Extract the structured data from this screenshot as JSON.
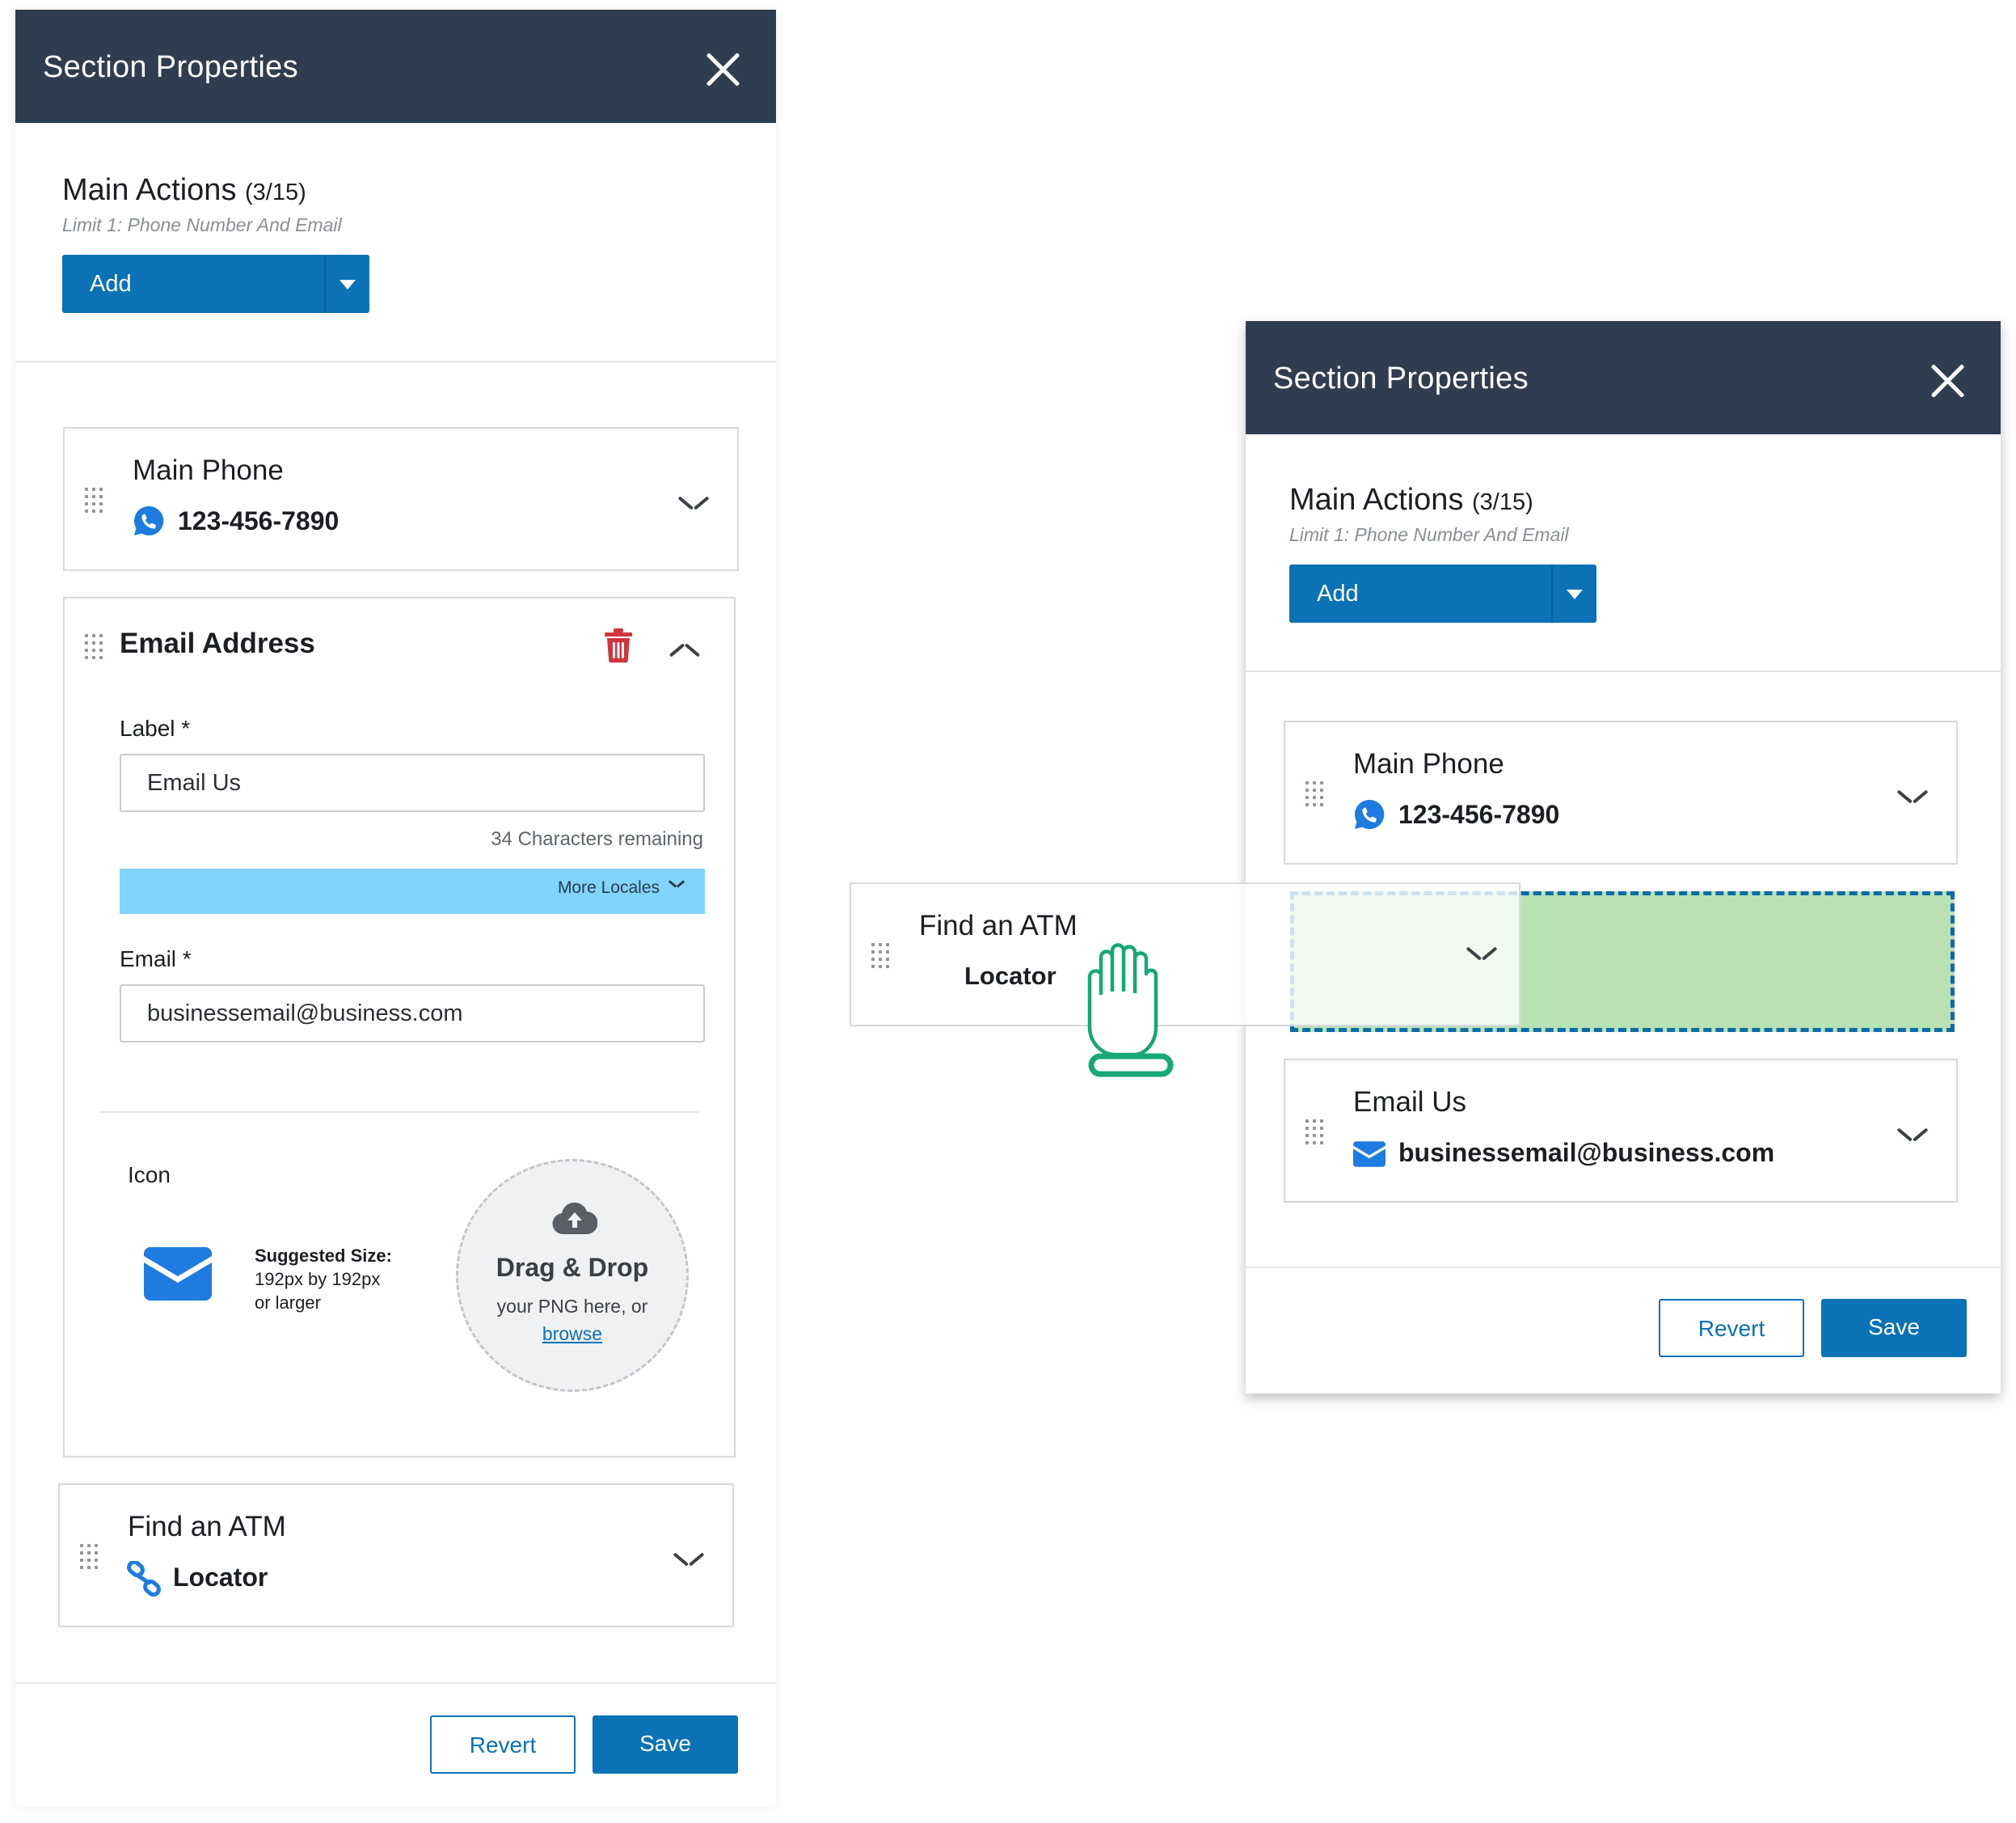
{
  "left_panel": {
    "title": "Section Properties",
    "main_actions": {
      "title": "Main Actions",
      "count": "(3/15)",
      "subtitle": "Limit 1: Phone Number And Email",
      "add_label": "Add"
    },
    "main_phone": {
      "title": "Main Phone",
      "value": "123-456-7890"
    },
    "email_card": {
      "title": "Email Address",
      "label_field": {
        "label": "Label *",
        "value": "Email Us"
      },
      "chars_remaining": "34 Characters remaining",
      "more_locales": "More Locales",
      "email_field": {
        "label": "Email *",
        "value": "businessemail@business.com"
      },
      "icon_label": "Icon",
      "suggested_size": {
        "heading": "Suggested Size:",
        "line1": "192px by 192px",
        "line2": "or larger"
      },
      "drop_zone": {
        "title": "Drag & Drop",
        "subtitle": "your PNG here, or",
        "link": "browse"
      }
    },
    "find_atm": {
      "title": "Find an ATM",
      "value": "Locator"
    },
    "revert_label": "Revert",
    "save_label": "Save"
  },
  "right_panel": {
    "title": "Section Properties",
    "main_actions": {
      "title": "Main Actions",
      "count": "(3/15)",
      "subtitle": "Limit 1: Phone Number And Email",
      "add_label": "Add"
    },
    "main_phone": {
      "title": "Main Phone",
      "value": "123-456-7890"
    },
    "email_us": {
      "title": "Email Us",
      "value": "businessemail@business.com"
    },
    "revert_label": "Revert",
    "save_label": "Save"
  },
  "dragged_card": {
    "title": "Find an ATM",
    "value": "Locator"
  },
  "icons": {
    "phone": "whatsapp-phone-icon",
    "email": "envelope-icon",
    "link": "chain-link-icon",
    "delete": "trash-icon",
    "upload": "cloud-upload-icon",
    "cursor": "grab-hand-icon"
  },
  "colors": {
    "header_bg": "#2f3d50",
    "primary": "#0a72b5",
    "locales_bg": "#80d4fd",
    "drop_target_bg": "#b8e2b4",
    "drop_target_border": "#0e6ba8",
    "delete_red": "#d0343c",
    "icon_blue": "#1e7be0",
    "cursor_green": "#16a877"
  }
}
